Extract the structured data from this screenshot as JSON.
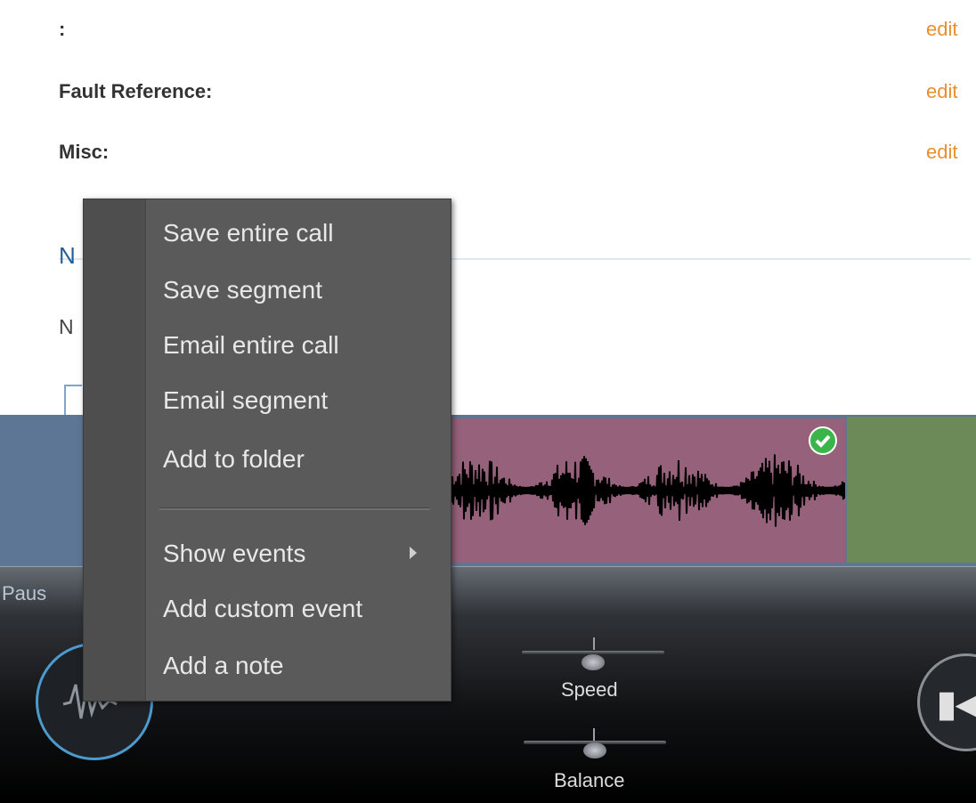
{
  "fields": [
    {
      "label": ":",
      "action": "edit"
    },
    {
      "label": "Fault Reference:",
      "action": "edit"
    },
    {
      "label": "Misc:",
      "action": "edit"
    }
  ],
  "notes": {
    "title": "N",
    "text": "N"
  },
  "player": {
    "status": "Paus",
    "speed_label": "Speed",
    "balance_label": "Balance"
  },
  "menu": {
    "items": [
      "Save entire call",
      "Save segment",
      "Email entire call",
      "Email segment",
      "Add to folder",
      "Show events",
      "Add custom event",
      "Add a note"
    ]
  },
  "colors": {
    "accent_link": "#e8902f",
    "segment_active": "#96617a",
    "segment_prev": "#5d7696",
    "segment_next": "#6c8a58",
    "menu_bg": "#5a5a5a"
  }
}
